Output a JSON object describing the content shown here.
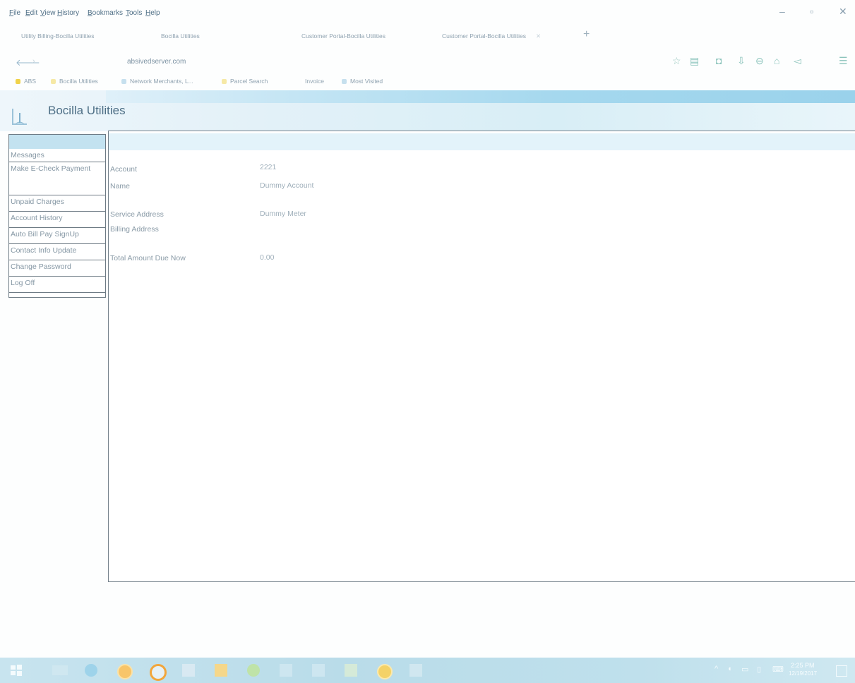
{
  "window": {
    "menus": [
      "File",
      "Edit",
      "View",
      "History",
      "Bookmarks",
      "Tools",
      "Help"
    ],
    "controls": {
      "minimize": "–",
      "restore": "▫",
      "close": "✕"
    }
  },
  "tabs": [
    {
      "label": "Utility Billing-Bocilla Utilities"
    },
    {
      "label": "Bocilla Utilities"
    },
    {
      "label": "Customer Portal-Bocilla Utilities"
    },
    {
      "label": "Customer Portal-Bocilla Utilities"
    }
  ],
  "newtab_label": "+",
  "nav": {
    "url_host": "absivedserver.com",
    "icons": [
      "star-icon",
      "reading-list-icon",
      "pocket-icon",
      "download-icon",
      "sync-icon",
      "home-icon",
      "send-icon",
      "hamburger-menu-icon"
    ]
  },
  "bookmarks": [
    {
      "label": "ABS",
      "color": "#f0d24a"
    },
    {
      "label": "Bocilla Utilities",
      "color": "#f0d24a"
    },
    {
      "label": "Network Merchants, L...",
      "color": "#9cc7e0"
    },
    {
      "label": "Parcel Search",
      "color": "#f0d24a"
    },
    {
      "label": "Invoice",
      "color": "#ffffff"
    },
    {
      "label": "Most Visited",
      "color": "#9cc7e0"
    }
  ],
  "site": {
    "title": "Bocilla Utilities"
  },
  "sidebar": {
    "items": [
      {
        "label": "Messages"
      },
      {
        "label": "Make E-Check Payment"
      },
      {
        "label": "Unpaid Charges"
      },
      {
        "label": "Account History"
      },
      {
        "label": "Auto Bill Pay SignUp"
      },
      {
        "label": "Contact Info Update"
      },
      {
        "label": "Change Password"
      },
      {
        "label": "Log Off"
      }
    ]
  },
  "account": {
    "account_label": "Account",
    "account_value": "2221",
    "name_label": "Name",
    "name_value": "Dummy Account",
    "service_address_label": "Service Address",
    "service_address_value": "Dummy Meter",
    "billing_address_label": "Billing Address",
    "billing_address_value": "",
    "total_due_label": "Total Amount Due Now",
    "total_due_value": "0.00"
  },
  "taskbar": {
    "clock_time": "2:25 PM",
    "clock_date": "12/19/2017",
    "colors": {
      "accent": "#b9dce9"
    }
  }
}
